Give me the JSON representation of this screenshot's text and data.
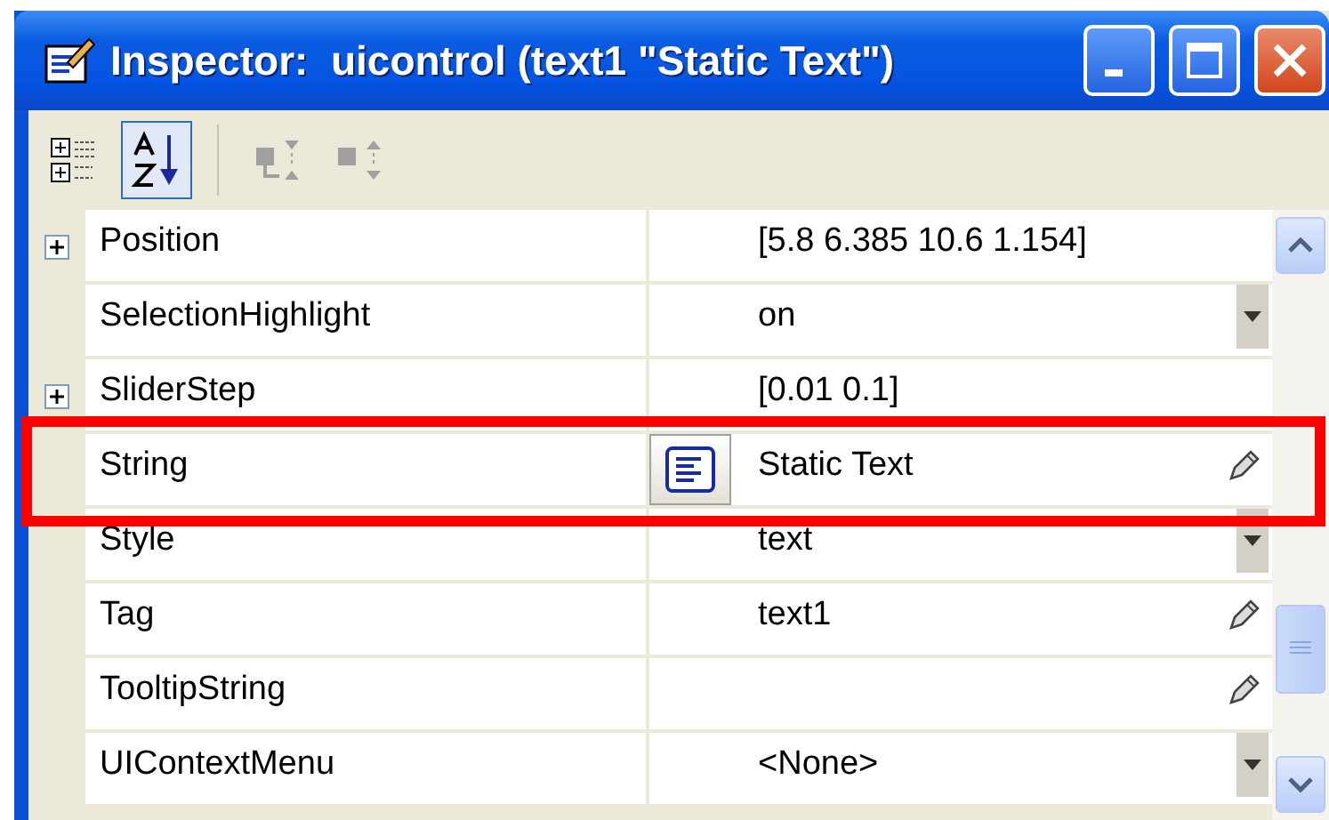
{
  "window": {
    "title": "Inspector:  uicontrol (text1 \"Static Text\")"
  },
  "toolbar": [
    {
      "kind": "categorized",
      "selected": false,
      "disabled": false
    },
    {
      "kind": "alphabetical",
      "selected": true,
      "disabled": false
    },
    {
      "kind": "collapse",
      "selected": false,
      "disabled": true
    },
    {
      "kind": "expand",
      "selected": false,
      "disabled": true
    }
  ],
  "properties": [
    {
      "name": "Position",
      "value": "[5.8 6.385 10.6 1.154]",
      "expandable": true,
      "kind": "plain",
      "text_button": false,
      "highlighted": false
    },
    {
      "name": "SelectionHighlight",
      "value": "on",
      "expandable": false,
      "kind": "dropdown",
      "text_button": false,
      "highlighted": false
    },
    {
      "name": "SliderStep",
      "value": "[0.01 0.1]",
      "expandable": true,
      "kind": "plain",
      "text_button": false,
      "highlighted": false
    },
    {
      "name": "String",
      "value": "Static Text",
      "expandable": false,
      "kind": "pencil",
      "text_button": true,
      "highlighted": true
    },
    {
      "name": "Style",
      "value": "text",
      "expandable": false,
      "kind": "dropdown",
      "text_button": false,
      "highlighted": false
    },
    {
      "name": "Tag",
      "value": "text1",
      "expandable": false,
      "kind": "pencil",
      "text_button": false,
      "highlighted": false
    },
    {
      "name": "TooltipString",
      "expandable": false,
      "kind": "pencil",
      "text_button": false,
      "highlighted": false
    },
    {
      "name": "UIContextMenu",
      "value": "<None>",
      "expandable": false,
      "kind": "dropdown",
      "text_button": false,
      "highlighted": false
    }
  ]
}
